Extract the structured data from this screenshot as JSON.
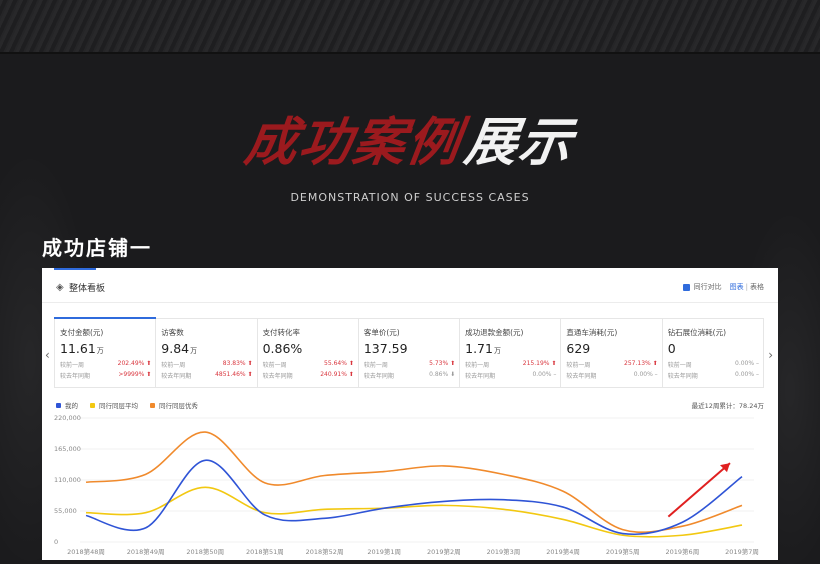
{
  "hero": {
    "title_red": "成功案例",
    "title_white": "展示",
    "subtitle": "DEMONSTRATION OF SUCCESS CASES"
  },
  "section": {
    "title": "成功店铺一"
  },
  "panel": {
    "title": "整体看板",
    "compare_label": "同行对比",
    "view_chart": "图表",
    "view_sep": "|",
    "view_table": "表格"
  },
  "kpis": [
    {
      "label": "支付金额(元)",
      "value": "11.61",
      "unit": "万",
      "l1_label": "较前一周",
      "l1_pct": "202.49%",
      "l1_dir": "up",
      "l2_label": "较去年同期",
      "l2_pct": ">9999%",
      "l2_dir": "up"
    },
    {
      "label": "访客数",
      "value": "9.84",
      "unit": "万",
      "l1_label": "较前一周",
      "l1_pct": "83.83%",
      "l1_dir": "up",
      "l2_label": "较去年同期",
      "l2_pct": "4851.46%",
      "l2_dir": "up"
    },
    {
      "label": "支付转化率",
      "value": "0.86%",
      "unit": "",
      "l1_label": "较前一周",
      "l1_pct": "55.64%",
      "l1_dir": "up",
      "l2_label": "较去年同期",
      "l2_pct": "240.91%",
      "l2_dir": "up"
    },
    {
      "label": "客单价(元)",
      "value": "137.59",
      "unit": "",
      "l1_label": "较前一周",
      "l1_pct": "5.73%",
      "l1_dir": "up",
      "l2_label": "较去年同期",
      "l2_pct": "0.86%",
      "l2_dir": "down"
    },
    {
      "label": "成功退款金额(元)",
      "value": "1.71",
      "unit": "万",
      "l1_label": "较前一周",
      "l1_pct": "215.19%",
      "l1_dir": "up",
      "l2_label": "较去年同期",
      "l2_pct": "0.00%",
      "l2_dir": "flat"
    },
    {
      "label": "直通车消耗(元)",
      "value": "629",
      "unit": "",
      "l1_label": "较前一周",
      "l1_pct": "257.13%",
      "l1_dir": "up",
      "l2_label": "较去年同期",
      "l2_pct": "0.00%",
      "l2_dir": "flat"
    },
    {
      "label": "钻石展位消耗(元)",
      "value": "0",
      "unit": "",
      "l1_label": "较前一周",
      "l1_pct": "0.00%",
      "l1_dir": "flat",
      "l2_label": "较去年同期",
      "l2_pct": "0.00%",
      "l2_dir": "flat"
    }
  ],
  "legend": {
    "items": [
      {
        "name": "我的",
        "color": "#2f54d6"
      },
      {
        "name": "同行同层平均",
        "color": "#f2c811"
      },
      {
        "name": "同行同层优秀",
        "color": "#f08a2c"
      }
    ],
    "summary": "最近12周累计：78.24万"
  },
  "chart_data": {
    "type": "line",
    "x": [
      "2018第48周",
      "2018第49周",
      "2018第50周",
      "2018第51周",
      "2018第52周",
      "2019第1周",
      "2019第2周",
      "2019第3周",
      "2019第4周",
      "2019第5周",
      "2019第6周",
      "2019第7周"
    ],
    "ylim": [
      0,
      220000
    ],
    "yticks": [
      "0",
      "55,000",
      "110,000",
      "165,000",
      "220,000"
    ],
    "ytick_values": [
      0,
      55000,
      110000,
      165000,
      220000
    ],
    "series": [
      {
        "name": "我的",
        "color": "#2f54d6",
        "values": [
          47000,
          25000,
          145000,
          48000,
          42000,
          60000,
          72000,
          75000,
          62000,
          15000,
          35000,
          116000
        ]
      },
      {
        "name": "同行同层平均",
        "color": "#f2c811",
        "values": [
          52000,
          52000,
          97000,
          52000,
          58000,
          60000,
          65000,
          58000,
          40000,
          12000,
          12000,
          30000
        ]
      },
      {
        "name": "同行同层优秀",
        "color": "#f08a2c",
        "values": [
          106000,
          120000,
          195000,
          105000,
          118000,
          125000,
          135000,
          120000,
          90000,
          22000,
          28000,
          65000
        ]
      }
    ],
    "grid": true,
    "legend_position": "top-left"
  }
}
